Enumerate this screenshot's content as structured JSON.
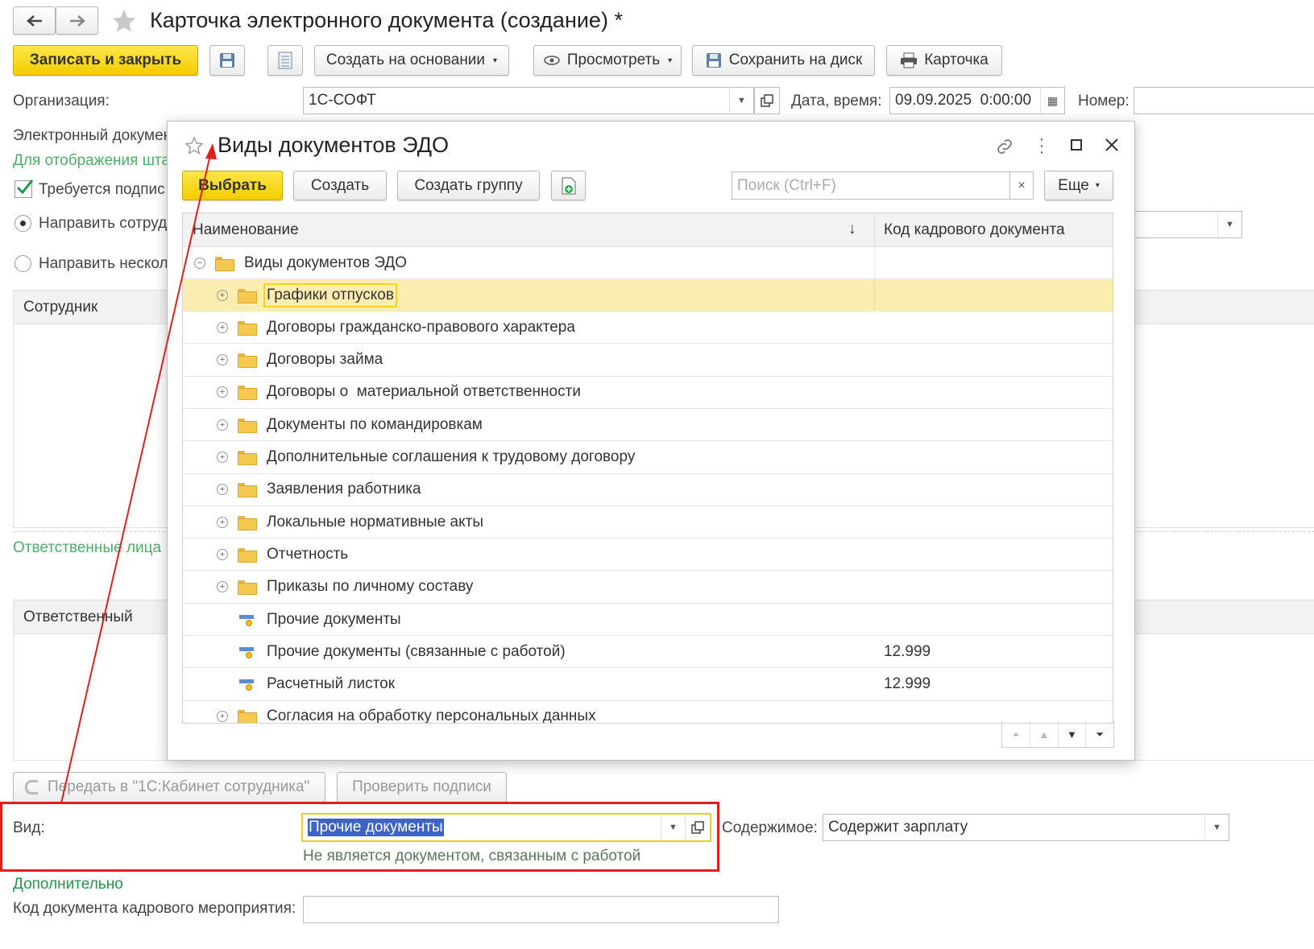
{
  "main": {
    "title": "Карточка электронного документа (создание) *",
    "toolbar": {
      "save_close": "Записать и закрыть",
      "create_based": "Создать на основании",
      "view": "Просмотреть",
      "save_disk": "Сохранить на диск",
      "card": "Карточка"
    },
    "org_label": "Организация:",
    "org_value": "1С-СОФТ",
    "date_label": "Дата, время:",
    "date_value": "09.09.2025  0:00:00",
    "number_label": "Номер:",
    "edoc_label": "Электронный докумен",
    "display_hint": "Для отображения шта",
    "signature_required": "Требуется подпис",
    "send_one": "Направить сотруд",
    "send_many": "Направить несколь",
    "employee_header": "Сотрудник",
    "responsible_section": "Ответственные лица",
    "responsible_header": "Ответственный",
    "send_cabinet": "Передать в \"1С:Кабинет сотрудника\"",
    "check_signatures": "Проверить подписи",
    "kind_label": "Вид:",
    "kind_value": "Прочие документы",
    "kind_hint": "Не является документом, связанным с работой",
    "content_label": "Содержимое:",
    "content_value": "Содержит зарплату",
    "additional": "Дополнительно",
    "hr_code_label": "Код документа кадрового мероприятия:"
  },
  "dialog": {
    "title": "Виды документов ЭДО",
    "select": "Выбрать",
    "create": "Создать",
    "create_group": "Создать группу",
    "search_placeholder": "Поиск (Ctrl+F)",
    "more": "Еще",
    "col_name": "Наименование",
    "col_code": "Код кадрового документа",
    "root": "Виды документов ЭДО",
    "rows": [
      {
        "name": "Графики отпусков",
        "code": "",
        "type": "folder"
      },
      {
        "name": "Договоры гражданско-правового характера",
        "code": "",
        "type": "folder"
      },
      {
        "name": "Договоры займа",
        "code": "",
        "type": "folder"
      },
      {
        "name": "Договоры о  материальной ответственности",
        "code": "",
        "type": "folder"
      },
      {
        "name": "Документы по командировкам",
        "code": "",
        "type": "folder"
      },
      {
        "name": "Дополнительные соглашения к трудовому договору",
        "code": "",
        "type": "folder"
      },
      {
        "name": "Заявления работника",
        "code": "",
        "type": "folder"
      },
      {
        "name": "Локальные нормативные акты",
        "code": "",
        "type": "folder"
      },
      {
        "name": "Отчетность",
        "code": "",
        "type": "folder"
      },
      {
        "name": "Приказы по личному составу",
        "code": "",
        "type": "folder"
      },
      {
        "name": "Прочие документы",
        "code": "",
        "type": "item"
      },
      {
        "name": "Прочие документы (связанные с работой)",
        "code": "12.999",
        "type": "item"
      },
      {
        "name": "Расчетный листок",
        "code": "12.999",
        "type": "item"
      },
      {
        "name": "Согласия на обработку персональных данных",
        "code": "",
        "type": "folder"
      }
    ]
  },
  "colors": {
    "accent_yellow": "#f5d21e",
    "highlight_row": "#fbedb0",
    "annotation_red": "#e0201c",
    "link_green": "#1f9a48"
  }
}
